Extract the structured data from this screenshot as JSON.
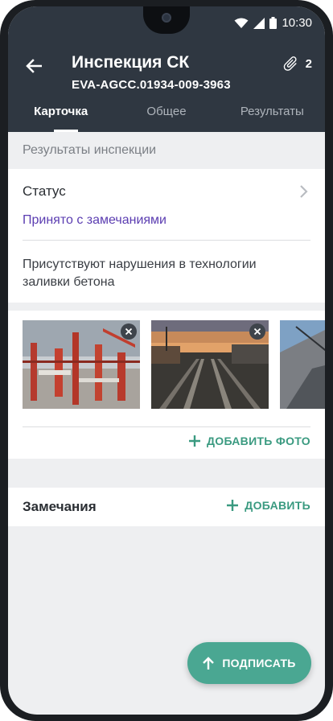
{
  "status_bar": {
    "time": "10:30"
  },
  "header": {
    "title": "Инспекция СК",
    "subtitle": "EVA-AGCC.01934-009-3963",
    "attachments_count": "2"
  },
  "tabs": [
    {
      "label": "Карточка",
      "active": true
    },
    {
      "label": "Общее",
      "active": false
    },
    {
      "label": "Результаты",
      "active": false
    }
  ],
  "section": {
    "title": "Результаты инспекции"
  },
  "status": {
    "label": "Статус",
    "value": "Принято с замечаниями"
  },
  "comment": "Присутствуют нарушения в технологии заливки бетона",
  "photos": {
    "items": [
      {
        "name": "construction-formwork-photo"
      },
      {
        "name": "railway-sunset-photo"
      },
      {
        "name": "crane-photo"
      }
    ],
    "add_label": "ДОБАВИТЬ ФОТО"
  },
  "remarks": {
    "label": "Замечания",
    "add_label": "ДОБАВИТЬ"
  },
  "fab": {
    "label": "ПОДПИСАТЬ"
  },
  "colors": {
    "appbar": "#2f3741",
    "accent": "#4aa792",
    "status_value": "#5b3db1"
  }
}
